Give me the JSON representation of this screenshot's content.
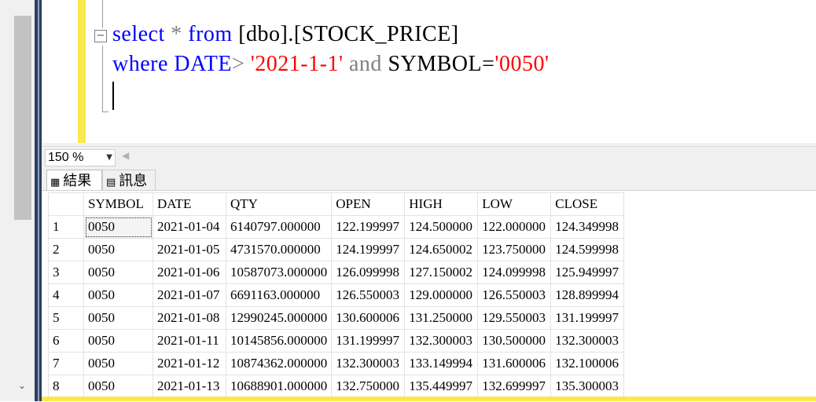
{
  "query": {
    "line1": {
      "kw1": "select",
      "star": " * ",
      "kw2": "from",
      "rest": " [dbo].[STOCK_PRICE]"
    },
    "line2": {
      "kw1": "where",
      "field": " DATE",
      "op": "> ",
      "val1": "'2021-1-1'",
      "and": " and ",
      "field2": "SYMBOL=",
      "val2": "'0050'"
    }
  },
  "zoom": {
    "value": "150 %"
  },
  "tabs": {
    "results": "結果",
    "messages": "訊息"
  },
  "grid": {
    "columns": [
      "SYMBOL",
      "DATE",
      "QTY",
      "OPEN",
      "HIGH",
      "LOW",
      "CLOSE"
    ],
    "rows": [
      [
        "1",
        "0050",
        "2021-01-04",
        "6140797.000000",
        "122.199997",
        "124.500000",
        "122.000000",
        "124.349998"
      ],
      [
        "2",
        "0050",
        "2021-01-05",
        "4731570.000000",
        "124.199997",
        "124.650002",
        "123.750000",
        "124.599998"
      ],
      [
        "3",
        "0050",
        "2021-01-06",
        "10587073.000000",
        "126.099998",
        "127.150002",
        "124.099998",
        "125.949997"
      ],
      [
        "4",
        "0050",
        "2021-01-07",
        "6691163.000000",
        "126.550003",
        "129.000000",
        "126.550003",
        "128.899994"
      ],
      [
        "5",
        "0050",
        "2021-01-08",
        "12990245.000000",
        "130.600006",
        "131.250000",
        "129.550003",
        "131.199997"
      ],
      [
        "6",
        "0050",
        "2021-01-11",
        "10145856.000000",
        "131.199997",
        "132.300003",
        "130.500000",
        "132.300003"
      ],
      [
        "7",
        "0050",
        "2021-01-12",
        "10874362.000000",
        "132.300003",
        "133.149994",
        "131.600006",
        "132.100006"
      ],
      [
        "8",
        "0050",
        "2021-01-13",
        "10688901.000000",
        "132.750000",
        "135.449997",
        "132.699997",
        "135.300003"
      ]
    ]
  }
}
